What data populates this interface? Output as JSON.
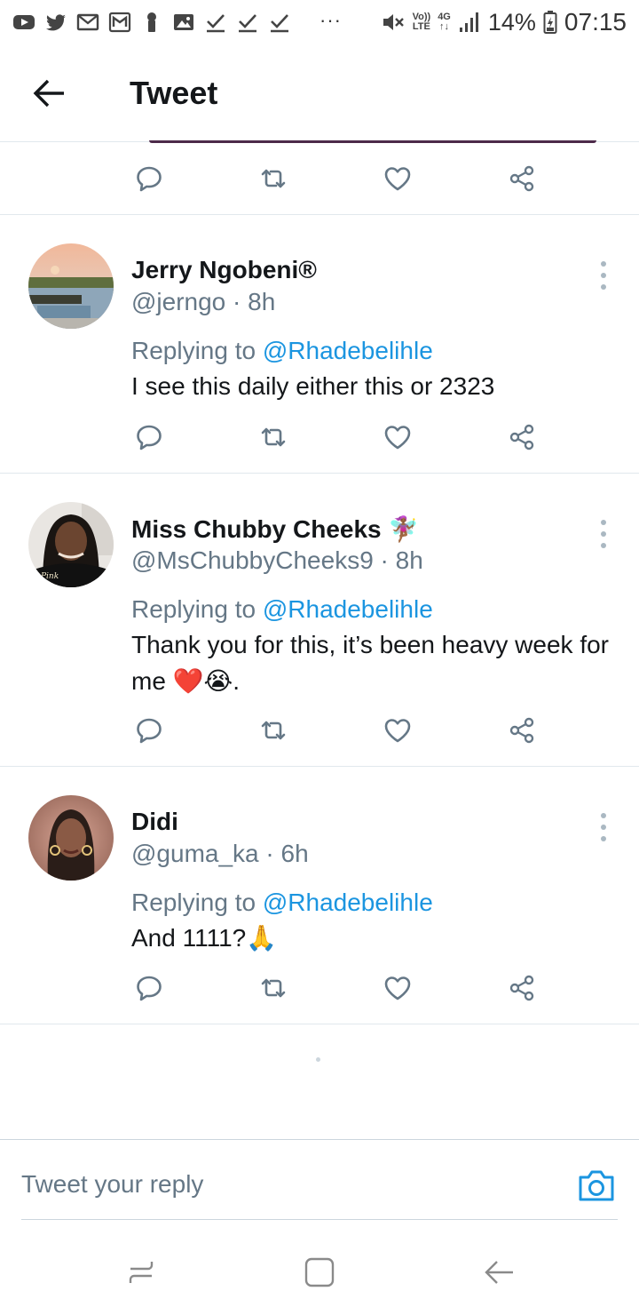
{
  "status_bar": {
    "left_icons": [
      "youtube-icon",
      "twitter-icon",
      "gmail-icon",
      "gmail-icon",
      "keyhole-icon",
      "gallery-icon",
      "check-icon",
      "check-icon",
      "check-icon"
    ],
    "more": "···",
    "volte_top": "Vo))",
    "volte_bottom": "LTE",
    "network_top": "4G",
    "network_bottom": "↑↓",
    "battery": "14%",
    "time": "07:15"
  },
  "header": {
    "title": "Tweet"
  },
  "tweets": [
    {
      "name": "Jerry Ngobeni®",
      "handle_time": "@jerngo · 8h",
      "replying_prefix": "Replying to ",
      "replying_to": "@Rhadebelihle",
      "text": "I see this daily either this or 2323"
    },
    {
      "name": "Miss Chubby Cheeks",
      "name_emoji": "🧚🏾‍♀️",
      "handle_time": "@MsChubbyCheeks9 · 8h",
      "replying_prefix": "Replying to ",
      "replying_to": "@Rhadebelihle",
      "text": "Thank you for this, it’s been heavy week for me ❤️😭."
    },
    {
      "name": "Didi",
      "handle_time": "@guma_ka · 6h",
      "replying_prefix": "Replying to ",
      "replying_to": "@Rhadebelihle",
      "text": "And 1111?🙏"
    }
  ],
  "reply_bar": {
    "placeholder": "Tweet your reply"
  },
  "colors": {
    "link": "#1b95e0",
    "secondary_text": "#657786",
    "icon": "#657786",
    "divider": "#e1e8ed"
  }
}
